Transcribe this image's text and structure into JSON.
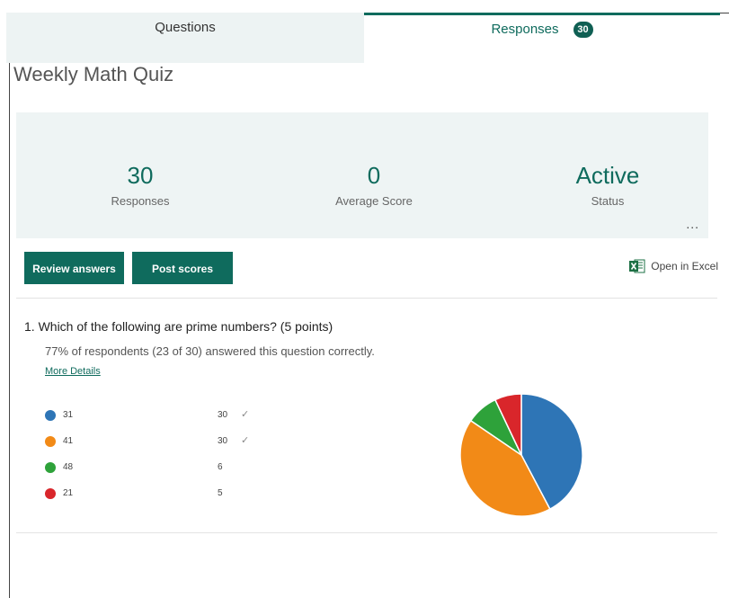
{
  "tabs": {
    "questions_label": "Questions",
    "responses_label": "Responses",
    "responses_badge": "30"
  },
  "form": {
    "title": "Weekly Math Quiz"
  },
  "summary": {
    "responses": {
      "value": "30",
      "label": "Responses"
    },
    "average": {
      "value": "0",
      "label": "Average Score"
    },
    "status": {
      "value": "Active",
      "label": "Status"
    },
    "more_label": "..."
  },
  "actions": {
    "review_label": "Review answers",
    "post_label": "Post scores",
    "excel_label": "Open in Excel",
    "excel_icon": "excel-icon"
  },
  "question": {
    "title": "1.  Which of the following are prime numbers? (5 points)",
    "subtitle": "77% of respondents (23 of 30) answered this question correctly.",
    "more_details": "More Details",
    "options": [
      {
        "label": "31",
        "count": 30,
        "correct": true,
        "color": "#2e75b6"
      },
      {
        "label": "41",
        "count": 30,
        "correct": true,
        "color": "#f28a17"
      },
      {
        "label": "48",
        "count": 6,
        "correct": false,
        "color": "#2ea23a"
      },
      {
        "label": "21",
        "count": 5,
        "correct": false,
        "color": "#d9262b"
      }
    ],
    "check_glyph": "✓"
  },
  "chart_data": {
    "type": "pie",
    "categories": [
      "31",
      "41",
      "48",
      "21"
    ],
    "values": [
      30,
      30,
      6,
      5
    ],
    "colors": [
      "#2e75b6",
      "#f28a17",
      "#2ea23a",
      "#d9262b"
    ]
  }
}
